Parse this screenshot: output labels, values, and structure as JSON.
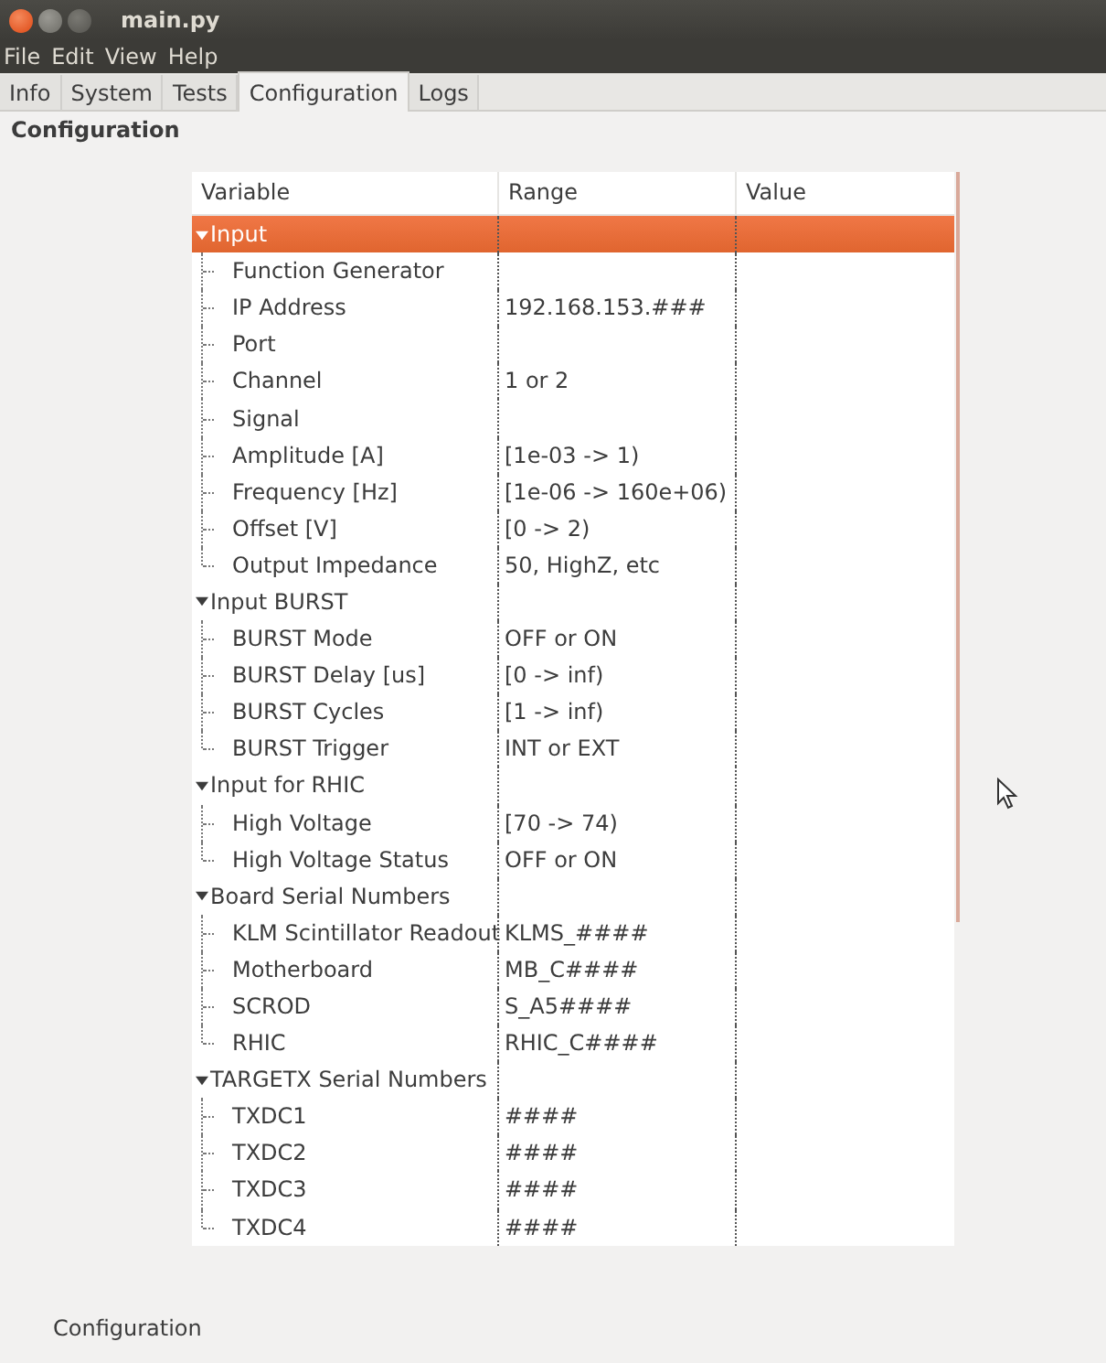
{
  "window": {
    "title": "main.py"
  },
  "menu": [
    "File",
    "Edit",
    "View",
    "Help"
  ],
  "tabs": [
    {
      "label": "Info",
      "selected": false
    },
    {
      "label": "System",
      "selected": false
    },
    {
      "label": "Tests",
      "selected": false
    },
    {
      "label": "Configuration",
      "selected": true
    },
    {
      "label": "Logs",
      "selected": false
    }
  ],
  "page_title": "Configuration",
  "table": {
    "columns": [
      "Variable",
      "Range",
      "Value"
    ],
    "groups": [
      {
        "name": "Input",
        "expanded": true,
        "selected": true,
        "children": [
          {
            "variable": "Function Generator"
          },
          {
            "variable": "IP Address",
            "range": "192.168.153.###"
          },
          {
            "variable": "Port"
          },
          {
            "variable": "Channel",
            "range": "1 or 2"
          },
          {
            "variable": "Signal"
          },
          {
            "variable": "Amplitude [A]",
            "range": "[1e-03 -> 1)"
          },
          {
            "variable": "Frequency [Hz]",
            "range": "[1e-06 -> 160e+06)"
          },
          {
            "variable": "Offset [V]",
            "range": "[0 -> 2)"
          },
          {
            "variable": "Output Impedance",
            "range": "50, HighZ, etc"
          }
        ]
      },
      {
        "name": "Input BURST",
        "expanded": true,
        "selected": false,
        "children": [
          {
            "variable": "BURST Mode",
            "range": "OFF or ON"
          },
          {
            "variable": "BURST Delay [us]",
            "range": "[0 -> inf)"
          },
          {
            "variable": "BURST Cycles",
            "range": "[1 -> inf)"
          },
          {
            "variable": "BURST Trigger",
            "range": "INT or EXT"
          }
        ]
      },
      {
        "name": "Input for RHIC",
        "expanded": true,
        "selected": false,
        "children": [
          {
            "variable": "High Voltage",
            "range": "[70 -> 74)"
          },
          {
            "variable": "High Voltage Status",
            "range": "OFF or ON"
          }
        ]
      },
      {
        "name": "Board Serial Numbers",
        "expanded": true,
        "selected": false,
        "children": [
          {
            "variable": "KLM Scintillator Readout",
            "range": "KLMS_####"
          },
          {
            "variable": "Motherboard",
            "range": "MB_C####"
          },
          {
            "variable": "SCROD",
            "range": "S_A5####"
          },
          {
            "variable": "RHIC",
            "range": "RHIC_C####"
          }
        ]
      },
      {
        "name": "TARGETX Serial Numbers",
        "expanded": true,
        "selected": false,
        "children": [
          {
            "variable": "TXDC1",
            "range": "####"
          },
          {
            "variable": "TXDC2",
            "range": "####"
          },
          {
            "variable": "TXDC3",
            "range": "####"
          },
          {
            "variable": "TXDC4",
            "range": "####"
          }
        ]
      }
    ]
  },
  "status_bar": "Configuration"
}
